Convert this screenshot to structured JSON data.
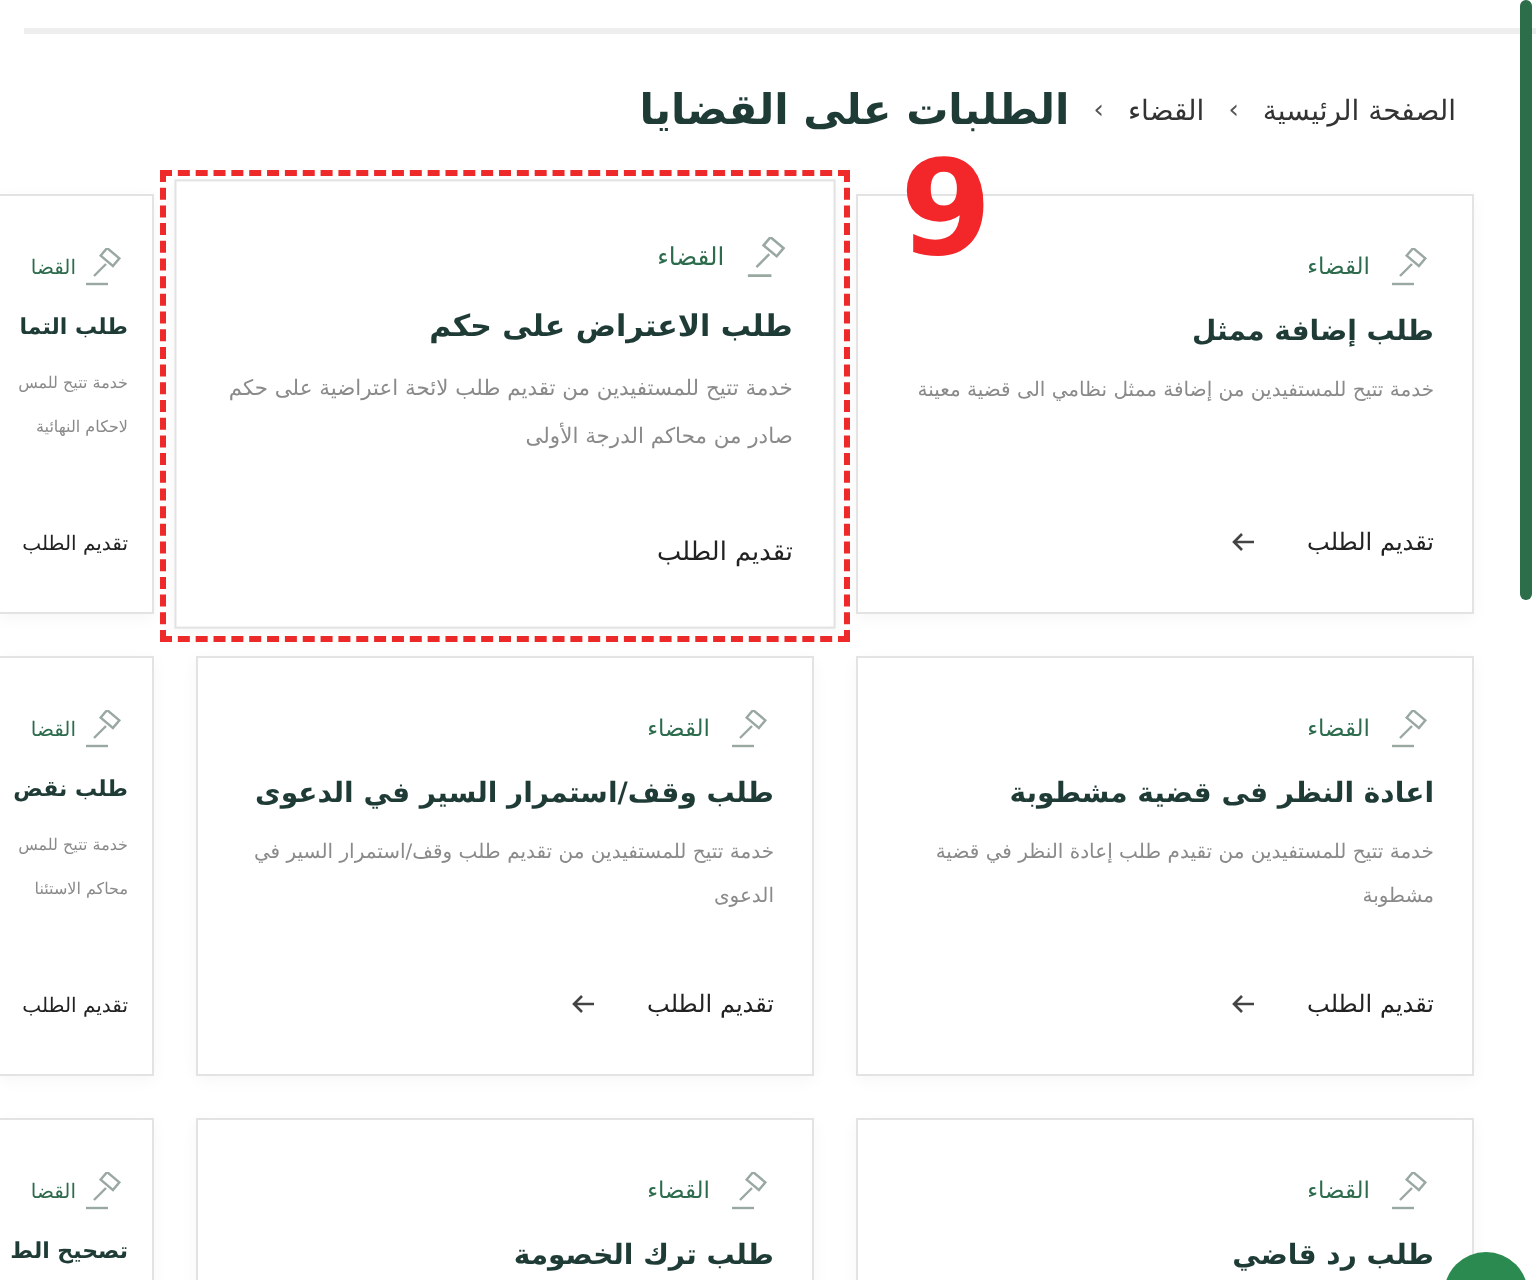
{
  "breadcrumb": {
    "items": [
      {
        "label": "الصفحة الرئيسية"
      },
      {
        "label": "القضاء"
      }
    ],
    "separator": "›",
    "current": "الطلبات على القضايا"
  },
  "cards": [
    {
      "kind": "full",
      "category": "القضاء",
      "title": "طلب إضافة ممثل",
      "description": "خدمة تتيح للمستفيدين من إضافة ممثل نظامي الى قضية معينة",
      "action": "تقديم الطلب",
      "highlighted": false
    },
    {
      "kind": "full",
      "category": "القضاء",
      "title": "طلب الاعتراض على حكم",
      "description": "خدمة تتيح للمستفيدين من تقديم طلب لائحة اعتراضية على حكم صادر من محاكم الدرجة الأولى",
      "action": "تقديم الطلب",
      "highlighted": true
    },
    {
      "kind": "clipped",
      "category": "القضا",
      "title": "طلب التما",
      "description_lines": [
        "خدمة تتيح للمس",
        "لاحكام النهائية"
      ],
      "action": "تقديم الطلب",
      "highlighted": false
    },
    {
      "kind": "full",
      "category": "القضاء",
      "title": "اعادة النظر فى قضية مشطوبة",
      "description": "خدمة تتيح للمستفيدين من تقيدم طلب إعادة النظر في قضية مشطوبة",
      "action": "تقديم الطلب",
      "highlighted": false
    },
    {
      "kind": "full",
      "category": "القضاء",
      "title": "طلب وقف/استمرار السير في الدعوى",
      "description": "خدمة تتيح للمستفيدين من تقديم طلب وقف/استمرار السير في الدعوى",
      "action": "تقديم الطلب",
      "highlighted": false
    },
    {
      "kind": "clipped",
      "category": "القضا",
      "title": "طلب نقض",
      "description_lines": [
        "خدمة تتيح للمس",
        "محاكم الاستئنا"
      ],
      "action": "تقديم الطلب",
      "highlighted": false
    },
    {
      "kind": "full",
      "category": "القضاء",
      "title": "طلب رد قاضي",
      "highlighted": false
    },
    {
      "kind": "full",
      "category": "القضاء",
      "title": "طلب ترك الخصومة",
      "highlighted": false
    },
    {
      "kind": "clipped",
      "category": "القضا",
      "title": "تصحيح الط",
      "highlighted": false
    }
  ],
  "annotation": {
    "label": "9"
  }
}
